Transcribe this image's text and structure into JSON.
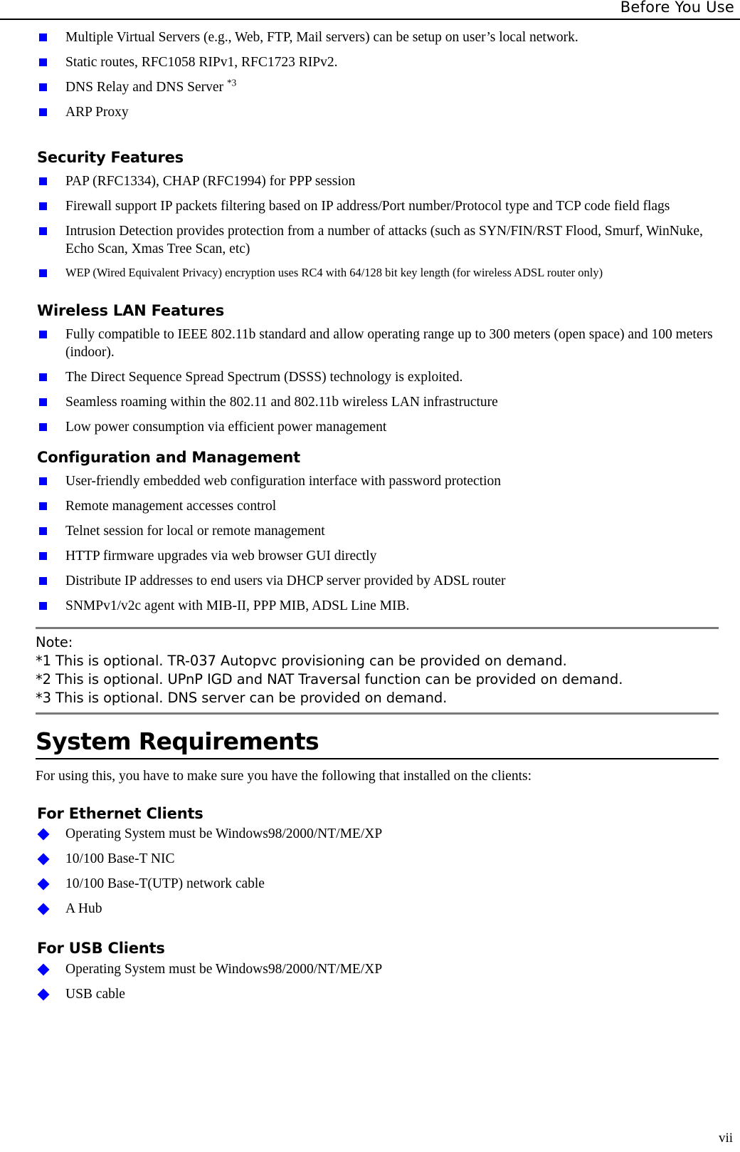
{
  "header": {
    "title": "Before You Use"
  },
  "intro_bullets": [
    "Multiple Virtual Servers (e.g., Web, FTP, Mail servers) can be setup on user’s local network.",
    "Static routes, RFC1058 RIPv1, RFC1723 RIPv2.",
    "ARP Proxy"
  ],
  "dns_bullet": {
    "text": "DNS Relay and DNS Server ",
    "superscript": "*3"
  },
  "security": {
    "heading": "Security Features",
    "bullets": [
      "PAP (RFC1334), CHAP (RFC1994) for PPP session",
      "Firewall support IP packets filtering based on IP address/Port number/Protocol type and TCP code field flags",
      "Intrusion Detection provides protection from a number of attacks (such as SYN/FIN/RST Flood, Smurf, WinNuke, Echo Scan, Xmas Tree Scan, etc)"
    ],
    "small_bullet": "WEP (Wired Equivalent Privacy) encryption uses RC4 with 64/128 bit key length (for wireless ADSL router only)"
  },
  "wireless": {
    "heading": "Wireless LAN Features",
    "bullets": [
      "Fully compatible to IEEE 802.11b standard and allow operating range up to 300 meters (open space) and 100 meters (indoor).",
      "The Direct Sequence Spread Spectrum (DSSS) technology is exploited.",
      "Seamless roaming within the 802.11 and 802.11b wireless LAN infrastructure",
      "Low power consumption via efficient power management"
    ]
  },
  "configuration": {
    "heading": "Configuration and Management",
    "bullets": [
      "User-friendly embedded web configuration interface with password protection",
      "Remote management accesses control",
      "Telnet session for local or remote management",
      "HTTP firmware upgrades via web browser GUI directly",
      "Distribute IP addresses to end users via DHCP server provided by ADSL router",
      "SNMPv1/v2c agent with MIB-II, PPP MIB, ADSL Line MIB."
    ]
  },
  "note": {
    "label": "Note:",
    "lines": [
      "*1 This is optional. TR-037 Autopvc provisioning can be provided on demand.",
      "*2 This is optional. UPnP IGD and NAT Traversal function can be provided on demand.",
      "*3 This is optional. DNS server can be provided on demand."
    ]
  },
  "system_requirements": {
    "title": "System Requirements",
    "intro": "For using this, you have to make sure you have the following that installed on the clients:",
    "ethernet": {
      "heading": "For Ethernet Clients",
      "bullets": [
        "Operating System must be Windows98/2000/NT/ME/XP",
        "10/100 Base-T NIC",
        "10/100 Base-T(UTP) network cable",
        "A Hub"
      ]
    },
    "usb": {
      "heading": "For USB Clients",
      "bullets": [
        "Operating System must be Windows98/2000/NT/ME/XP",
        "USB cable"
      ]
    }
  },
  "footer": {
    "page_number": "vii"
  },
  "colors": {
    "bullet_blue": "#0000FF",
    "rule_black": "#000000",
    "note_rule_gray": "#7A7A7A"
  }
}
